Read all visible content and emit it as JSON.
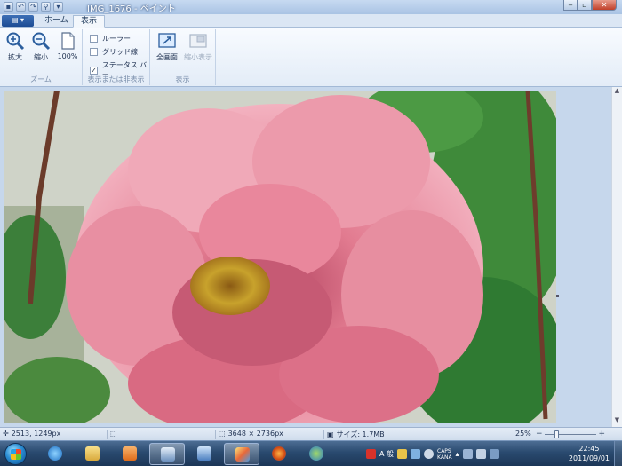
{
  "window": {
    "title": "IMG_1676 - ペイント",
    "minimize_glyph": "‒",
    "maximize_glyph": "▫",
    "close_glyph": "✕"
  },
  "qat": {
    "items": [
      "save-icon",
      "undo-icon",
      "redo-icon",
      "zoom-icon",
      "customize-icon"
    ]
  },
  "tabs": {
    "app_menu_label": "▤ ▾",
    "home": "ホーム",
    "view": "表示"
  },
  "ribbon": {
    "zoom_group": {
      "label": "ズーム",
      "zoom_in": "拡大",
      "zoom_out": "縮小",
      "zoom_100": "100%"
    },
    "show_hide_group": {
      "label": "表示または非表示",
      "ruler": "ルーラー",
      "ruler_checked": false,
      "gridlines": "グリッド線",
      "gridlines_checked": false,
      "statusbar": "ステータス バー",
      "statusbar_checked": true,
      "check_mark": "✓"
    },
    "display_group": {
      "label": "表示",
      "fullscreen": "全画面",
      "thumbnail": "縮小表示"
    }
  },
  "statusbar": {
    "cursor_pos": "2513, 1249px",
    "image_size": "3648 × 2736px",
    "file_size": "サイズ: 1.7MB",
    "zoom": "25%",
    "zoom_fraction": 0.25,
    "zoom_minus": "−",
    "zoom_plus": "+"
  },
  "taskbar": {
    "tray_ime": "A 般",
    "tray_caps": "CAPS",
    "tray_kana": "KANA",
    "time": "22:45",
    "date": "2011/09/01"
  },
  "colors": {
    "petal_light": "#f0a9b8",
    "petal_mid": "#e27b90",
    "petal_dark": "#b64763",
    "stamen": "#c8a22c",
    "leaf": "#3f8a3a"
  }
}
